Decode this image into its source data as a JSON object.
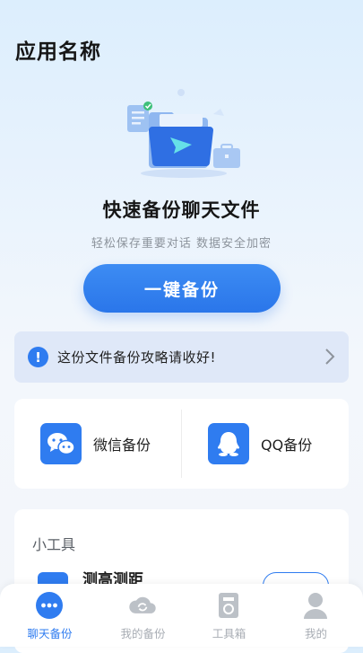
{
  "app": {
    "title": "应用名称"
  },
  "hero": {
    "headline": "快速备份聊天文件",
    "subline": "轻松保存重要对话 数据安全加密",
    "button_label": "一键备份"
  },
  "notice": {
    "text": "这份文件备份攻略请收好!"
  },
  "backup_tools": [
    {
      "label": "微信备份",
      "icon": "wechat-icon"
    },
    {
      "label": "QQ备份",
      "icon": "qq-icon"
    }
  ],
  "small_tools": {
    "title": "小工具",
    "items": [
      {
        "name": "测高测距"
      }
    ]
  },
  "tabbar": {
    "items": [
      {
        "label": "聊天备份",
        "icon": "chat-icon",
        "active": true
      },
      {
        "label": "我的备份",
        "icon": "cloud-sync-icon",
        "active": false
      },
      {
        "label": "工具箱",
        "icon": "toolbox-icon",
        "active": false
      },
      {
        "label": "我的",
        "icon": "user-icon",
        "active": false
      }
    ]
  },
  "colors": {
    "accent": "#2f7cf0",
    "inactive": "#a8adb4",
    "notice_bg": "#dfe8f8"
  }
}
